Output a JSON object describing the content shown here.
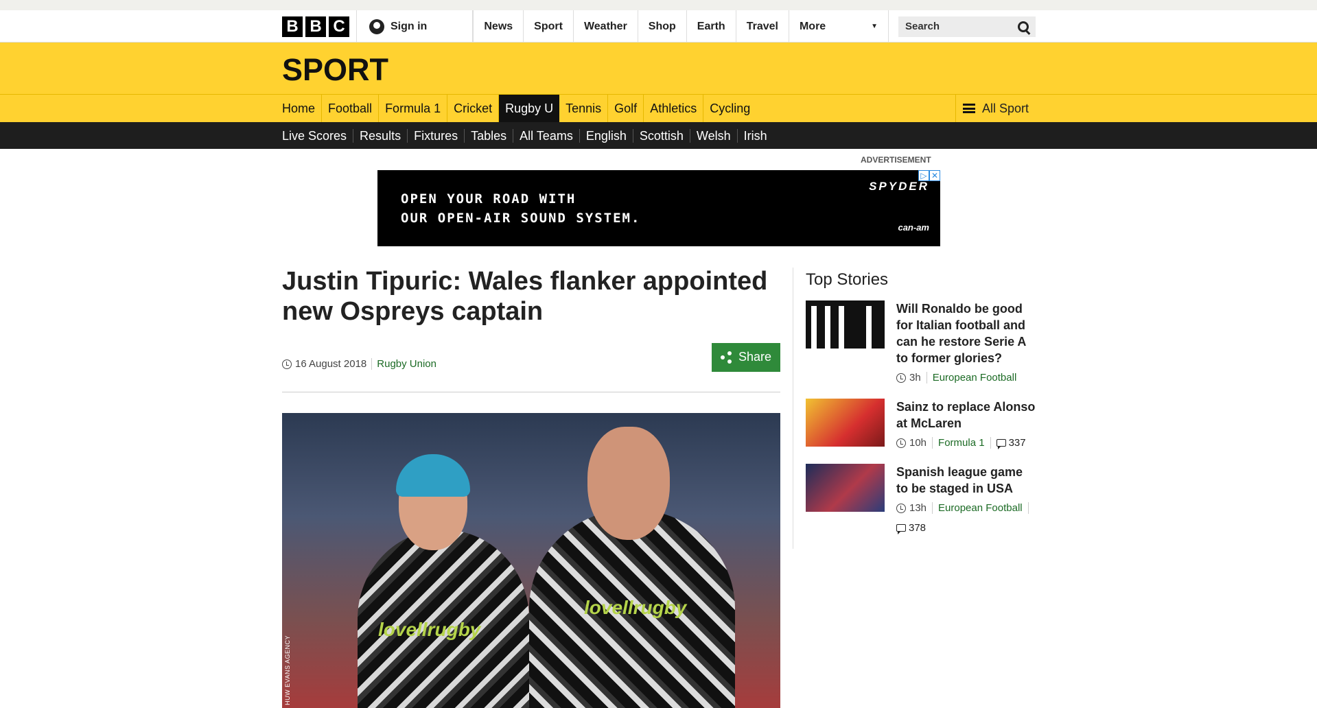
{
  "header": {
    "logo_letters": [
      "B",
      "B",
      "C"
    ],
    "signin": "Sign in",
    "nav": [
      "News",
      "Sport",
      "Weather",
      "Shop",
      "Earth",
      "Travel"
    ],
    "more": "More",
    "search_placeholder": "Search"
  },
  "sport": {
    "title": "SPORT",
    "nav": [
      "Home",
      "Football",
      "Formula 1",
      "Cricket",
      "Rugby U",
      "Tennis",
      "Golf",
      "Athletics",
      "Cycling"
    ],
    "active": "Rugby U",
    "all_sport": "All Sport",
    "subnav": [
      "Live Scores",
      "Results",
      "Fixtures",
      "Tables",
      "All Teams",
      "English",
      "Scottish",
      "Welsh",
      "Irish"
    ]
  },
  "ad": {
    "label": "ADVERTISEMENT",
    "line1": "OPEN YOUR ROAD WITH",
    "line2": "OUR OPEN-AIR SOUND SYSTEM.",
    "brand": "SPYDER",
    "brand2": "can-am"
  },
  "article": {
    "headline": "Justin Tipuric: Wales flanker appointed new Ospreys captain",
    "date": "16 August 2018",
    "category": "Rugby Union",
    "share": "Share",
    "image_sponsor": "lovellrugby",
    "image_credit": "HUW EVANS AGENCY"
  },
  "sidebar": {
    "title": "Top Stories",
    "stories": [
      {
        "title": "Will Ronaldo be good for Italian football and can he restore Serie A to former glories?",
        "time": "3h",
        "category": "European Football",
        "comments": ""
      },
      {
        "title": "Sainz to replace Alonso at McLaren",
        "time": "10h",
        "category": "Formula 1",
        "comments": "337"
      },
      {
        "title": "Spanish league game to be staged in USA",
        "time": "13h",
        "category": "European Football",
        "comments": "378"
      }
    ]
  }
}
